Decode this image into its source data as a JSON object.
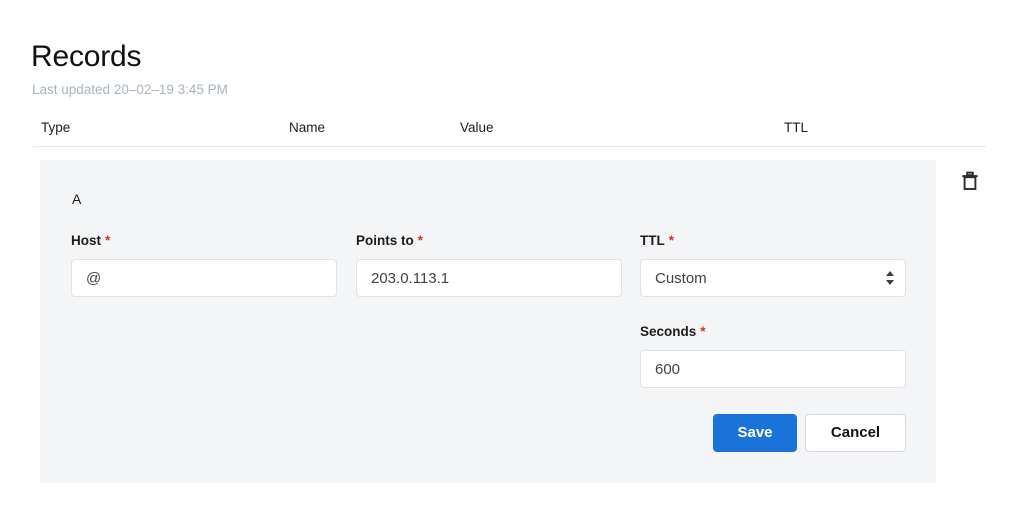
{
  "header": {
    "title": "Records",
    "last_updated": "Last updated 20–02–19 3:45 PM"
  },
  "table": {
    "columns": [
      "Type",
      "Name",
      "Value",
      "TTL"
    ]
  },
  "record": {
    "type": "A",
    "delete_icon": "trash-icon",
    "fields": {
      "host": {
        "label": "Host",
        "required_marker": "*",
        "value": "@",
        "placeholder": ""
      },
      "points_to": {
        "label": "Points to",
        "required_marker": "*",
        "value": "203.0.113.1",
        "placeholder": ""
      },
      "ttl": {
        "label": "TTL",
        "required_marker": "*",
        "value": "Custom",
        "options": [
          "Custom"
        ],
        "stepper_icon": "stepper-updown-icon"
      },
      "seconds": {
        "label": "Seconds",
        "required_marker": "*",
        "value": "600",
        "placeholder": ""
      }
    },
    "actions": {
      "save_label": "Save",
      "cancel_label": "Cancel"
    }
  },
  "colors": {
    "accent": "#1a73d9",
    "required": "#d93025",
    "panel_bg": "#f4f5f7",
    "muted_text": "#a9b3bf",
    "divider": "#e4e6e9"
  }
}
